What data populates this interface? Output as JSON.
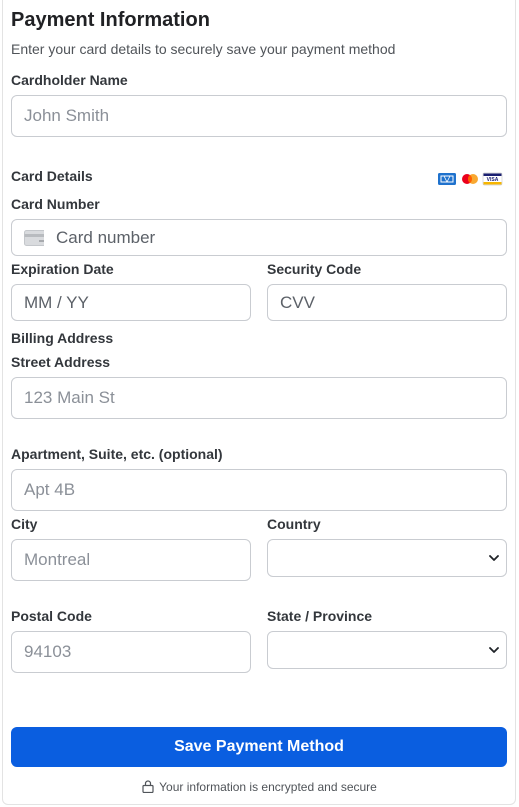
{
  "header": {
    "title": "Payment Information",
    "subtitle": "Enter your card details to securely save your payment method"
  },
  "cardholder": {
    "label": "Cardholder Name",
    "placeholder": "John Smith"
  },
  "card_details": {
    "label": "Card Details",
    "brands": [
      "amex-icon",
      "mastercard-icon",
      "visa-icon"
    ],
    "visa_text": "VISA",
    "number_label": "Card Number",
    "number_placeholder": "Card number",
    "expiry_label": "Expiration Date",
    "expiry_placeholder": "MM / YY",
    "cvc_label": "Security Code",
    "cvc_placeholder": "CVV"
  },
  "billing": {
    "label": "Billing Address",
    "street_label": "Street Address",
    "street_placeholder": "123 Main St",
    "apt_label": "Apartment, Suite, etc. (optional)",
    "apt_placeholder": "Apt 4B",
    "city_label": "City",
    "city_placeholder": "Montreal",
    "country_label": "Country",
    "country_value": "",
    "postal_label": "Postal Code",
    "postal_placeholder": "94103",
    "state_label": "State / Province",
    "state_value": ""
  },
  "submit_label": "Save Payment Method",
  "secure_note": "Your information is encrypted and secure",
  "colors": {
    "primary": "#0a5ee0",
    "border": "#c9ccd1"
  }
}
